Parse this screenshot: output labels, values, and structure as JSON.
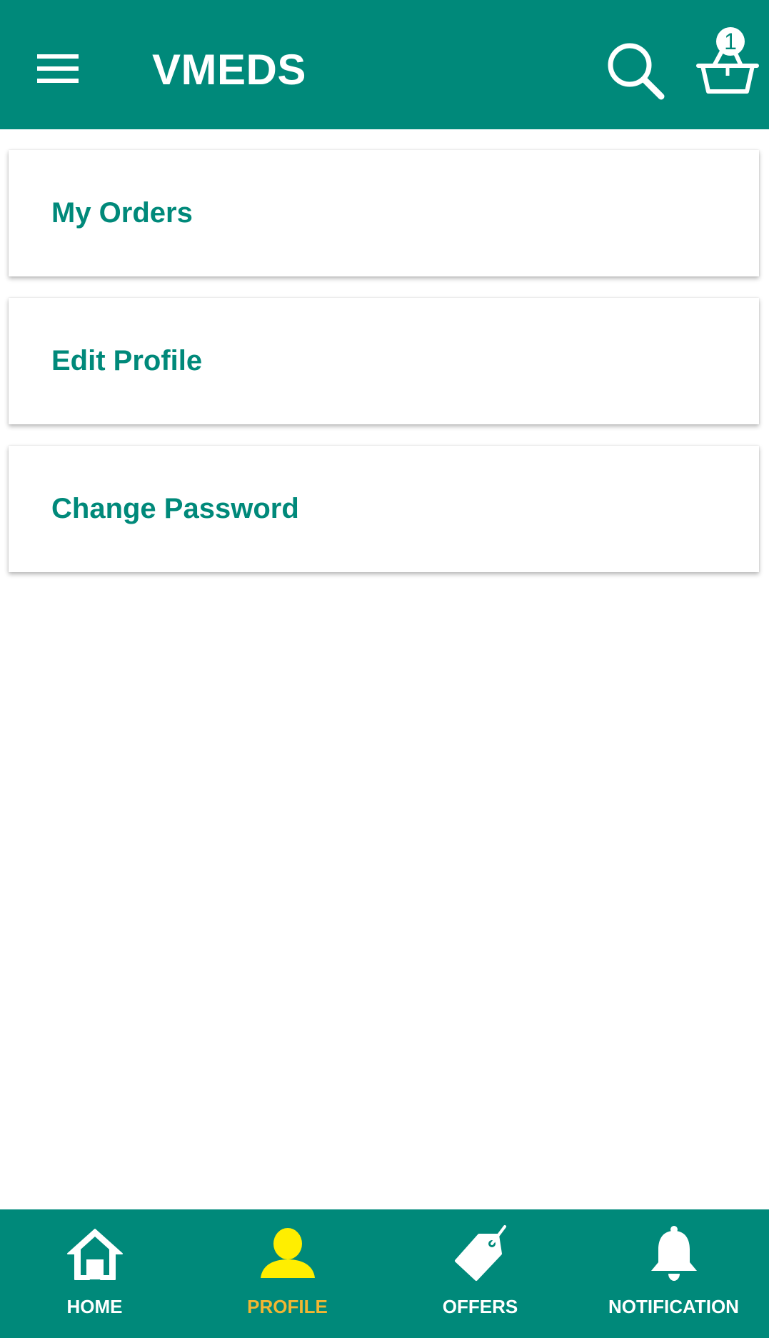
{
  "header": {
    "title": "VMEDS",
    "menu_icon": "hamburger-menu-icon",
    "search_icon": "search-icon",
    "cart_icon": "cart-basket-icon",
    "cart_count": "1"
  },
  "menu": {
    "items": [
      {
        "label": "My Orders"
      },
      {
        "label": "Edit Profile"
      },
      {
        "label": "Change Password"
      }
    ]
  },
  "bottom_nav": {
    "items": [
      {
        "label": "HOME",
        "icon": "home-icon"
      },
      {
        "label": "PROFILE",
        "icon": "profile-icon",
        "active": true
      },
      {
        "label": "OFFERS",
        "icon": "offers-tag-icon"
      },
      {
        "label": "NOTIFICATION",
        "icon": "bell-icon"
      }
    ]
  },
  "colors": {
    "primary": "#00897a",
    "active_label": "#f2b632",
    "active_icon": "#ffee00",
    "text_on_primary": "#ffffff"
  }
}
